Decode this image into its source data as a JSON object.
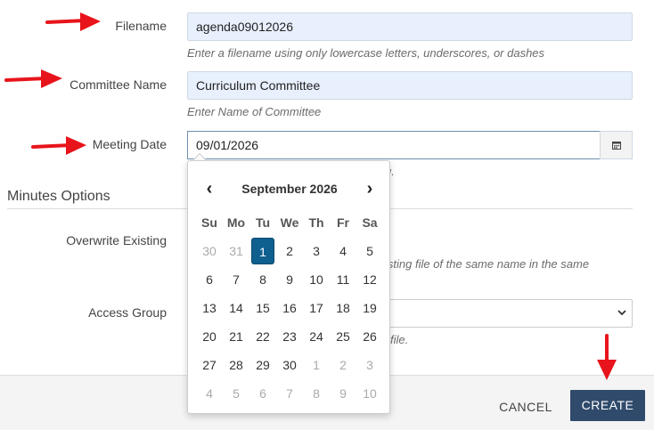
{
  "form": {
    "filename_label": "Filename",
    "filename_value": "agenda09012026",
    "filename_help": "Enter a filename using only lowercase letters, underscores, or dashes",
    "committee_label": "Committee Name",
    "committee_value": "Curriculum Committee",
    "committee_help": "Enter Name of Committee",
    "date_label": "Meeting Date",
    "date_value": "09/01/2026",
    "date_help_tail": "g.",
    "section_title": "Minutes Options",
    "overwrite_label": "Overwrite Existing",
    "overwrite_help": "isting file of the same name in the same",
    "access_label": "Access Group",
    "access_help": "file."
  },
  "calendar": {
    "prev": "‹",
    "next": "›",
    "title": "September 2026",
    "weekdays": [
      "Su",
      "Mo",
      "Tu",
      "We",
      "Th",
      "Fr",
      "Sa"
    ],
    "weeks": [
      [
        "30",
        "31",
        "1",
        "2",
        "3",
        "4",
        "5"
      ],
      [
        "6",
        "7",
        "8",
        "9",
        "10",
        "11",
        "12"
      ],
      [
        "13",
        "14",
        "15",
        "16",
        "17",
        "18",
        "19"
      ],
      [
        "20",
        "21",
        "22",
        "23",
        "24",
        "25",
        "26"
      ],
      [
        "27",
        "28",
        "29",
        "30",
        "1",
        "2",
        "3"
      ],
      [
        "4",
        "5",
        "6",
        "7",
        "8",
        "9",
        "10"
      ]
    ],
    "selected_day": "1"
  },
  "footer": {
    "cancel_label": "CANCEL",
    "create_label": "CREATE"
  },
  "colors": {
    "primary": "#2f4a6b",
    "selected_day": "#0f5f8f",
    "autofill_bg": "#e8f0fe",
    "annotation_arrow": "#e8141b"
  },
  "icons": {
    "calendar_button": "calendar-icon",
    "select_chevron": "chevron-down-icon"
  }
}
